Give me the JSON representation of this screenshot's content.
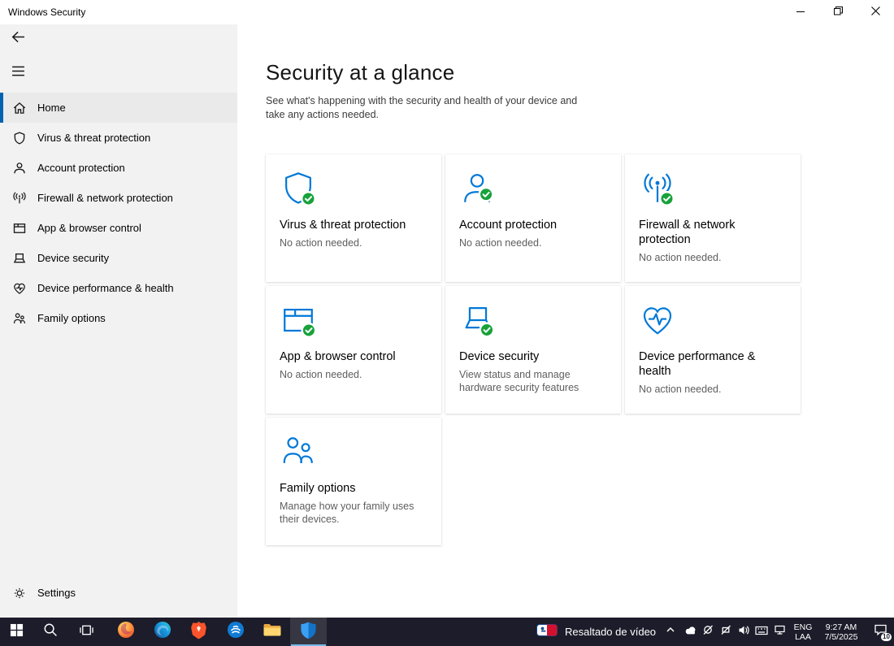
{
  "window": {
    "title": "Windows Security",
    "controls": {
      "minimize": "minimize",
      "restore": "restore-down",
      "close": "close"
    }
  },
  "sidebar": {
    "back_icon": "back-arrow-icon",
    "menu_icon": "hamburger-menu-icon",
    "items": [
      {
        "label": "Home",
        "icon": "home-icon",
        "selected": true
      },
      {
        "label": "Virus & threat protection",
        "icon": "shield-icon",
        "selected": false
      },
      {
        "label": "Account protection",
        "icon": "person-icon",
        "selected": false
      },
      {
        "label": "Firewall & network protection",
        "icon": "network-waves-icon",
        "selected": false
      },
      {
        "label": "App & browser control",
        "icon": "app-window-icon",
        "selected": false
      },
      {
        "label": "Device security",
        "icon": "laptop-icon",
        "selected": false
      },
      {
        "label": "Device performance & health",
        "icon": "heart-pulse-icon",
        "selected": false
      },
      {
        "label": "Family options",
        "icon": "family-icon",
        "selected": false
      }
    ],
    "settings": {
      "label": "Settings",
      "icon": "gear-icon"
    }
  },
  "main": {
    "title": "Security at a glance",
    "subtitle": "See what's happening with the security and health of your device and take any actions needed.",
    "tiles": [
      {
        "title": "Virus & threat protection",
        "description": "No action needed.",
        "icon": "shield-check-icon",
        "status_ok": true
      },
      {
        "title": "Account protection",
        "description": "No action needed.",
        "icon": "person-check-icon",
        "status_ok": true
      },
      {
        "title": "Firewall & network protection",
        "description": "No action needed.",
        "icon": "network-check-icon",
        "status_ok": true
      },
      {
        "title": "App & browser control",
        "description": "No action needed.",
        "icon": "app-window-check-icon",
        "status_ok": true
      },
      {
        "title": "Device security",
        "description": "View status and manage hardware security features",
        "icon": "laptop-check-icon",
        "status_ok": true
      },
      {
        "title": "Device performance & health",
        "description": "No action needed.",
        "icon": "heart-pulse-icon",
        "status_ok": false
      },
      {
        "title": "Family options",
        "description": "Manage how your family uses their devices.",
        "icon": "family-icon",
        "status_ok": false
      }
    ]
  },
  "taskbar": {
    "buttons": [
      "start",
      "search",
      "task-view"
    ],
    "apps": [
      "firefox",
      "edge",
      "brave",
      "blue-app",
      "file-explorer",
      "windows-security"
    ],
    "active_app": "windows-security",
    "media_label": "Resaltado de vídeo",
    "media_icon": "mlb-logo-icon",
    "tray_icons": [
      "chevron-up",
      "onedrive-cloud",
      "disabled-circle",
      "disabled-device",
      "volume",
      "touch-keyboard",
      "wired-network"
    ],
    "language_line1": "ENG",
    "language_line2": "LAA",
    "time": "9:27 AM",
    "date": "7/5/2025",
    "notification_count": "10"
  },
  "colors": {
    "accent_blue": "#0078d7",
    "status_green": "#17a23a",
    "nav_accent": "#0063b1",
    "sidebar_bg": "#f2f2f2",
    "taskbar_bg": "#1c1c2a"
  }
}
